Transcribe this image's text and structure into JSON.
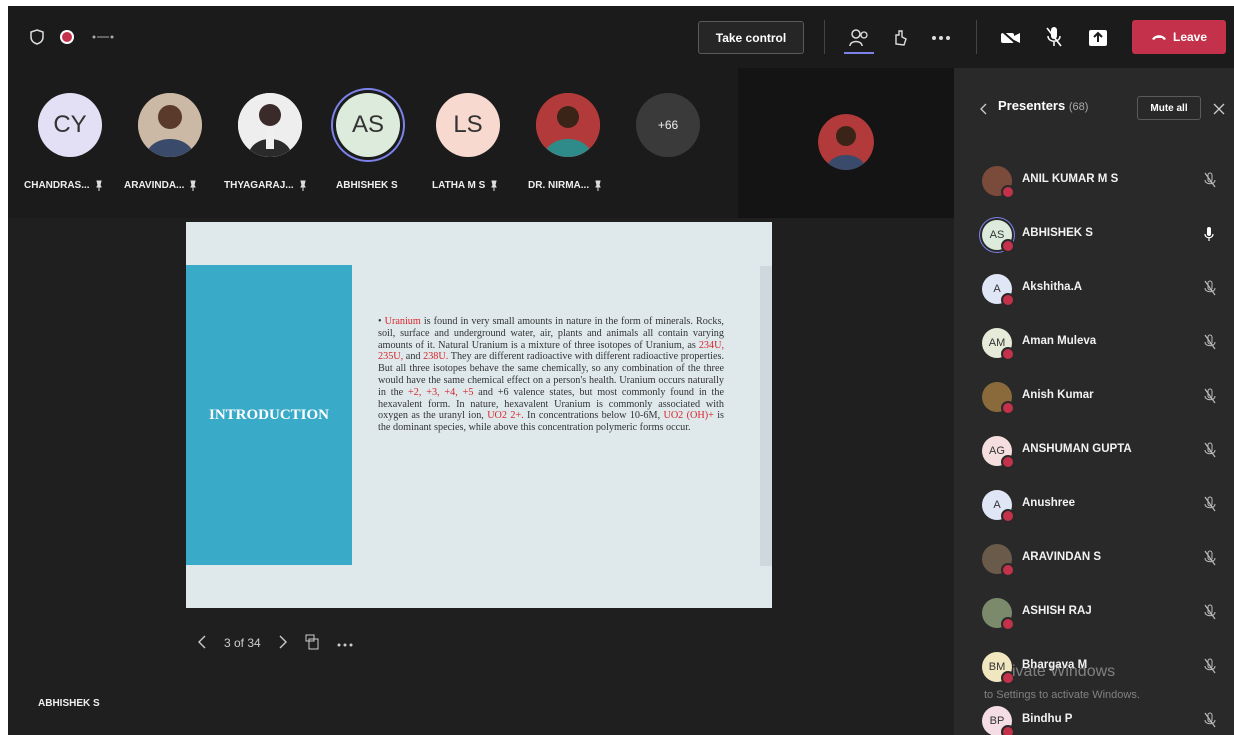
{
  "toolbar": {
    "take_control_label": "Take control",
    "leave_label": "Leave",
    "icons": [
      "shield-icon",
      "record-icon",
      "dots-icon",
      "participants-icon",
      "reactions-icon",
      "more-icon",
      "camera-off-icon",
      "mic-off-icon",
      "share-icon",
      "phone-icon"
    ]
  },
  "participants": [
    {
      "initials": "CY",
      "name": "CHANDRAS...",
      "avatar_color": "#e3e0f5"
    },
    {
      "initials": "",
      "name": "ARAVINDA...",
      "avatar_color": "#8a7a6a"
    },
    {
      "initials": "",
      "name": "THYAGARAJ...",
      "avatar_color": "#d8d8d8"
    },
    {
      "initials": "AS",
      "name": "ABHISHEK S",
      "avatar_color": "#dcebdc"
    },
    {
      "initials": "LS",
      "name": "LATHA M S",
      "avatar_color": "#f7d9d0"
    },
    {
      "initials": "",
      "name": "DR. NIRMA...",
      "avatar_color": "#b33a3a"
    },
    {
      "initials": "+66",
      "name": "",
      "avatar_color": "#3a3a3a"
    }
  ],
  "slide": {
    "heading": "INTRODUCTION",
    "text_parts": [
      {
        "t": "Uranium",
        "red": true
      },
      {
        "t": " is found in very small amounts in nature in the form of minerals. Rocks, soil, surface and underground water, air, plants and animals all contain varying amounts of it. Natural Uranium is a mixture of three isotopes of Uranium, as ",
        "red": false
      },
      {
        "t": "234U, 235U,",
        "red": true
      },
      {
        "t": " and ",
        "red": false
      },
      {
        "t": "238U.",
        "red": true
      },
      {
        "t": " They are different radioactive with different radioactive properties. But all three isotopes behave the same chemically, so any combination of the three would have the same chemical effect on a person's health. Uranium occurs naturally in the ",
        "red": false
      },
      {
        "t": "+2, +3, +4, +5",
        "red": true
      },
      {
        "t": " and +6 valence states, but most commonly found in the hexavalent form. In nature, hexavalent Uranium is commonly associated with oxygen as the uranyl ion, ",
        "red": false
      },
      {
        "t": "UO2 2+.",
        "red": true
      },
      {
        "t": " In concentrations below 10-6M, ",
        "red": false
      },
      {
        "t": "UO2 (OH)+",
        "red": true
      },
      {
        "t": " is the dominant species, while above this concentration polymeric forms occur.",
        "red": false
      }
    ],
    "page_indicator": "3 of 34"
  },
  "presenter_name": "ABHISHEK S",
  "panel": {
    "title": "Presenters",
    "count": "(68)",
    "mute_all_label": "Mute all",
    "people": [
      {
        "initials": "",
        "name": "ANIL KUMAR M S",
        "avatar_color": "#7a4b3a",
        "mic": "off"
      },
      {
        "initials": "AS",
        "name": "ABHISHEK S",
        "avatar_color": "#dcebdc",
        "mic": "on"
      },
      {
        "initials": "A",
        "name": "Akshitha.A",
        "avatar_color": "#dfe6f5",
        "mic": "off"
      },
      {
        "initials": "AM",
        "name": "Aman Muleva",
        "avatar_color": "#e6ead8",
        "mic": "off"
      },
      {
        "initials": "",
        "name": "Anish Kumar",
        "avatar_color": "#8a6a3a",
        "mic": "off"
      },
      {
        "initials": "AG",
        "name": "ANSHUMAN GUPTA",
        "avatar_color": "#f5dede",
        "mic": "off"
      },
      {
        "initials": "A",
        "name": "Anushree",
        "avatar_color": "#dfe6f5",
        "mic": "off"
      },
      {
        "initials": "",
        "name": "ARAVINDAN S",
        "avatar_color": "#6a5a4a",
        "mic": "off"
      },
      {
        "initials": "",
        "name": "ASHISH RAJ",
        "avatar_color": "#7a8a6a",
        "mic": "off"
      },
      {
        "initials": "BM",
        "name": "Bhargava M",
        "avatar_color": "#f0e6c0",
        "mic": "off"
      },
      {
        "initials": "BP",
        "name": "Bindhu P",
        "avatar_color": "#f5dde6",
        "mic": "off"
      }
    ]
  },
  "watermark": {
    "line1": "ivate Windows",
    "line2": "to Settings to activate Windows."
  }
}
